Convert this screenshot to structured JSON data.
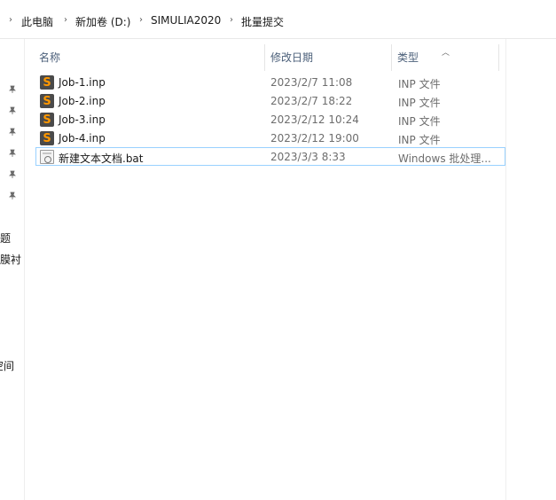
{
  "breadcrumb": {
    "items": [
      "此电脑",
      "新加卷 (D:)",
      "SIMULIA2020",
      "批量提交"
    ]
  },
  "columns": {
    "name": "名称",
    "date_modified": "修改日期",
    "type": "类型"
  },
  "nav": {
    "pinned_count": 6,
    "labels": [
      "题",
      "膜衬",
      "空间"
    ]
  },
  "files": [
    {
      "name": "Job-1.inp",
      "date": "2023/2/7 11:08",
      "type": "INP 文件",
      "icon": "sublime-file-icon"
    },
    {
      "name": "Job-2.inp",
      "date": "2023/2/7 18:22",
      "type": "INP 文件",
      "icon": "sublime-file-icon"
    },
    {
      "name": "Job-3.inp",
      "date": "2023/2/12 10:24",
      "type": "INP 文件",
      "icon": "sublime-file-icon"
    },
    {
      "name": "Job-4.inp",
      "date": "2023/2/12 19:00",
      "type": "INP 文件",
      "icon": "sublime-file-icon"
    },
    {
      "name": "新建文本文档.bat",
      "date": "2023/3/3 8:33",
      "type": "Windows 批处理...",
      "icon": "batch-file-icon",
      "selected": true
    }
  ],
  "colors": {
    "selection_border": "#99d1ff",
    "header_text": "#4c607a",
    "sublime_orange": "#ff9800"
  }
}
